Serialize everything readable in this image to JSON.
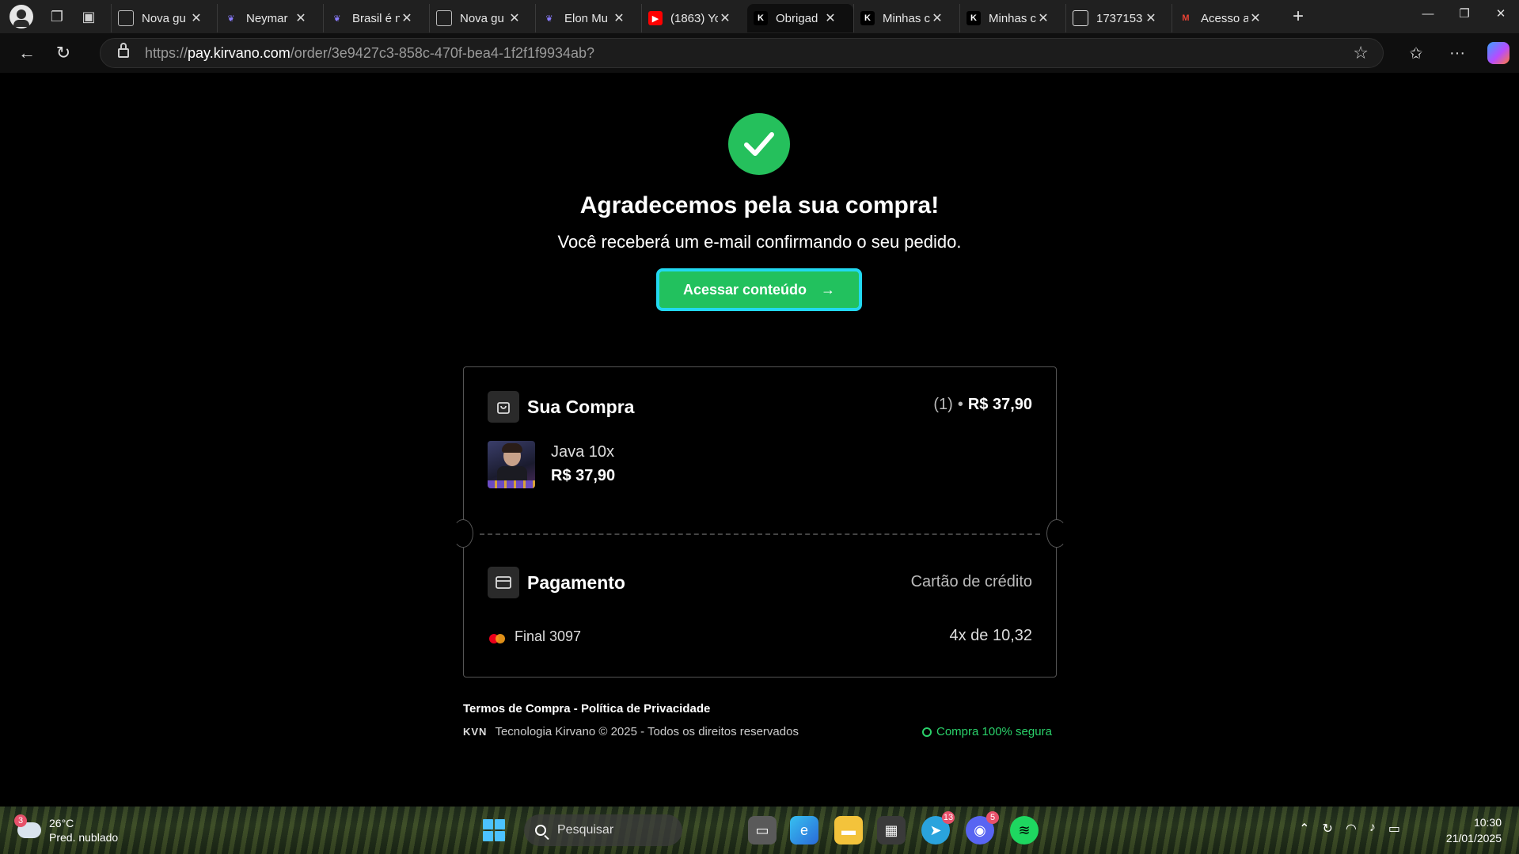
{
  "browser": {
    "tabs": [
      {
        "title": "Nova gu",
        "favicon": "page-icon",
        "active": false
      },
      {
        "title": "Neymar",
        "favicon": "gemini-butterfly-icon",
        "active": false
      },
      {
        "title": "Brasil é n",
        "favicon": "gemini-butterfly-icon",
        "active": false
      },
      {
        "title": "Nova gu",
        "favicon": "page-icon",
        "active": false
      },
      {
        "title": "Elon Mu",
        "favicon": "gemini-butterfly-icon",
        "active": false
      },
      {
        "title": "(1863) Yo",
        "favicon": "youtube-icon",
        "active": false
      },
      {
        "title": "Obrigad",
        "favicon": "kirvano-k-icon",
        "active": true
      },
      {
        "title": "Minhas c",
        "favicon": "kirvano-k-icon",
        "active": false
      },
      {
        "title": "Minhas c",
        "favicon": "kirvano-k-icon",
        "active": false
      },
      {
        "title": "1737153",
        "favicon": "file-icon",
        "active": false
      },
      {
        "title": "Acesso a",
        "favicon": "gmail-icon",
        "active": false
      }
    ],
    "url_prefix": "https://",
    "url_host": "pay.kirvano.com",
    "url_path": "/order/3e9427c3-858c-470f-bea4-1f2f1f9934ab?"
  },
  "page": {
    "title": "Agradecemos pela sua compra!",
    "subtitle": "Você receberá um e-mail confirmando o seu pedido.",
    "cta_label": "Acessar conteúdo",
    "cta_arrow": "→",
    "purchase": {
      "section_title": "Sua Compra",
      "quantity": "(1)",
      "separator": "•",
      "total": "R$ 37,90",
      "product_name": "Java 10x",
      "product_price": "R$ 37,90"
    },
    "payment": {
      "section_title": "Pagamento",
      "method": "Cartão de crédito",
      "card_final": "Final 3097",
      "installments": "4x de 10,32"
    },
    "footer": {
      "terms": "Termos de Compra",
      "link_sep": " - ",
      "privacy": "Política de Privacidade",
      "logo_text": "KVN",
      "copyright": "Tecnologia Kirvano © 2025 - Todos os direitos reservados",
      "secure": "Compra 100% segura"
    }
  },
  "taskbar": {
    "weather_temp": "26°C",
    "weather_desc": "Pred. nublado",
    "weather_badge": "3",
    "search_placeholder": "Pesquisar",
    "telegram_badge": "13",
    "discord_badge": "5",
    "time": "10:30",
    "date": "21/01/2025"
  },
  "colors": {
    "accent_green": "#22c15e",
    "cta_border": "#22d8f0",
    "secure_green": "#2ad16a"
  }
}
